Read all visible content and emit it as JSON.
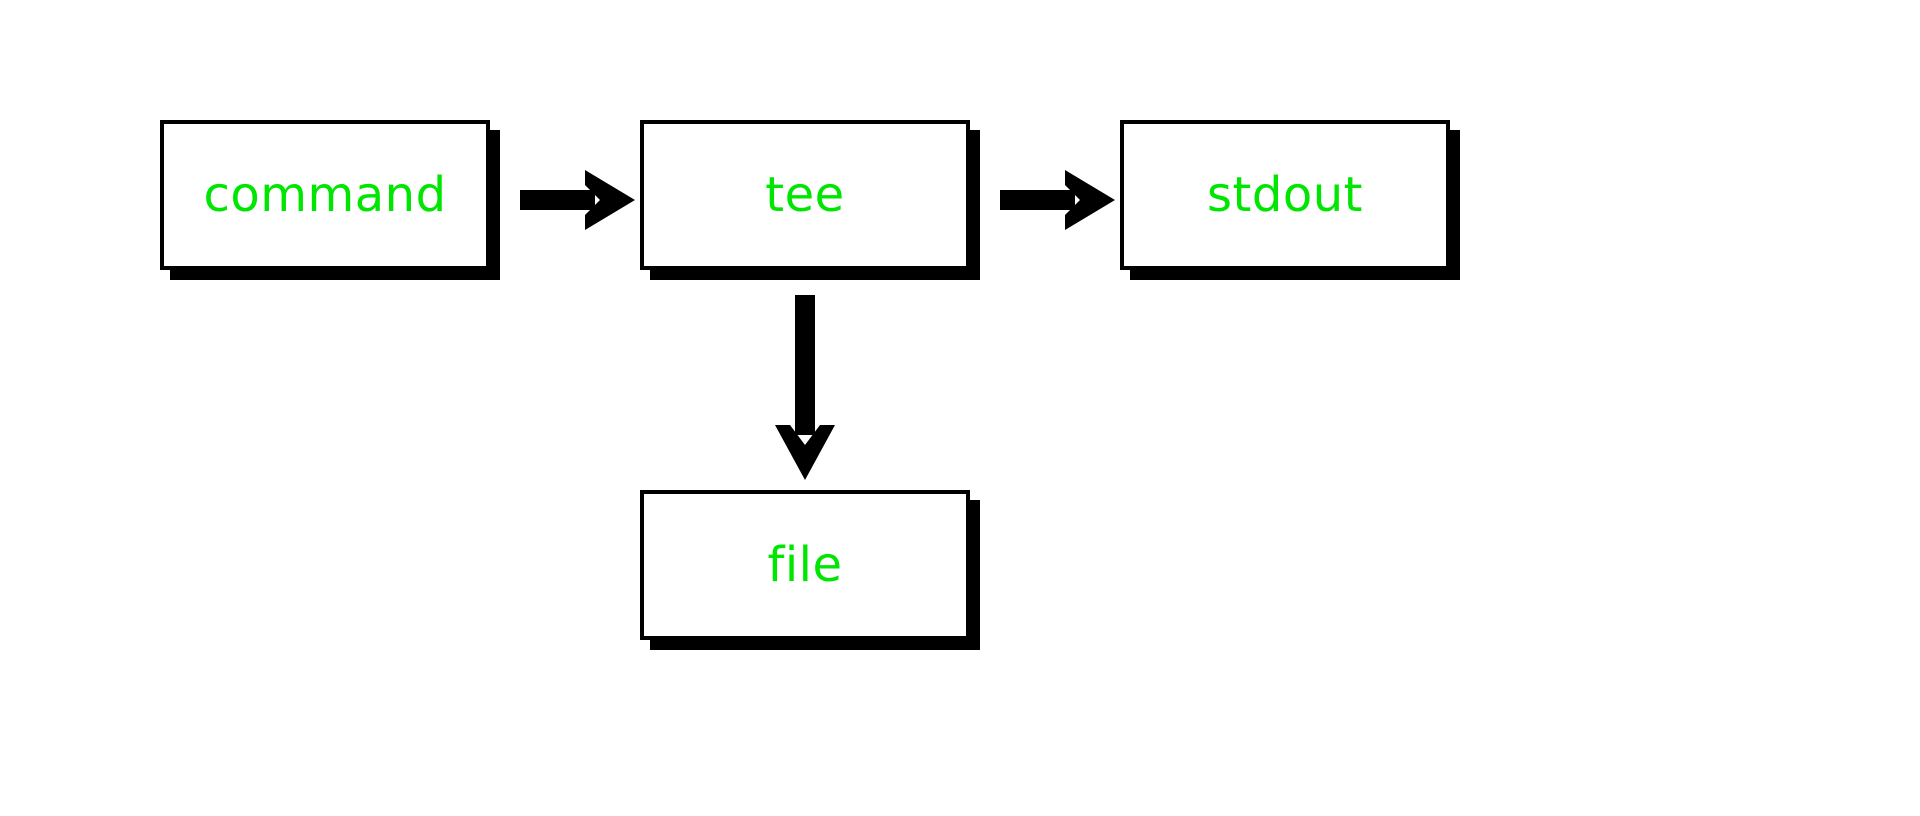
{
  "diagram": {
    "nodes": {
      "command": {
        "label": "command"
      },
      "tee": {
        "label": "tee"
      },
      "stdout": {
        "label": "stdout"
      },
      "file": {
        "label": "file"
      }
    },
    "edges": [
      {
        "from": "command",
        "to": "tee",
        "dir": "right"
      },
      {
        "from": "tee",
        "to": "stdout",
        "dir": "right"
      },
      {
        "from": "tee",
        "to": "file",
        "dir": "down"
      }
    ],
    "colors": {
      "text": "#00e600",
      "stroke": "#000000",
      "bg": "#ffffff"
    }
  }
}
